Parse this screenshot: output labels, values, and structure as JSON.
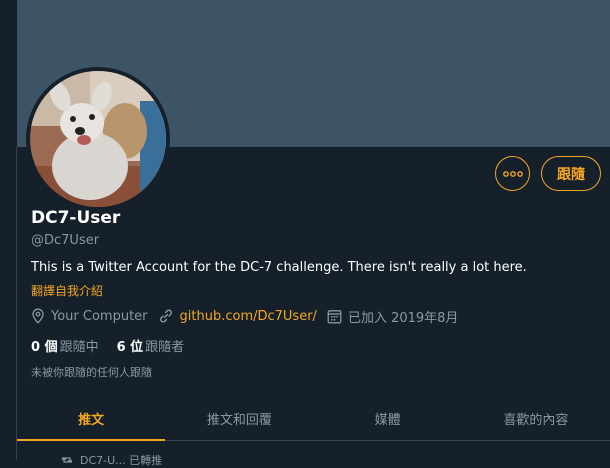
{
  "profile": {
    "name": "DC7-User",
    "handle": "@Dc7User",
    "bio": "This is a Twitter Account for the DC-7 challenge. There isn't really a lot here.",
    "translate_label": "翻譯自我介紹",
    "location": "Your Computer",
    "website": "github.com/Dc7User/",
    "joined": "已加入 2019年8月",
    "following_count": "0 個",
    "following_label": "跟隨中",
    "followers_count": "6 位",
    "followers_label": "跟隨者",
    "not_followed_note": "未被你跟隨的任何人跟隨"
  },
  "actions": {
    "follow_label": "跟隨",
    "more_icon": "more-dots-icon"
  },
  "tabs": [
    {
      "label": "推文",
      "active": true
    },
    {
      "label": "推文和回覆",
      "active": false
    },
    {
      "label": "媒體",
      "active": false
    },
    {
      "label": "喜歡的內容",
      "active": false
    }
  ],
  "retweet_row": {
    "icon": "retweet-icon",
    "text": "DC7-U... 已轉推"
  },
  "colors": {
    "accent": "#f5a623",
    "background": "#15202b",
    "banner": "#3d5467",
    "secondary_text": "#8899a6"
  }
}
